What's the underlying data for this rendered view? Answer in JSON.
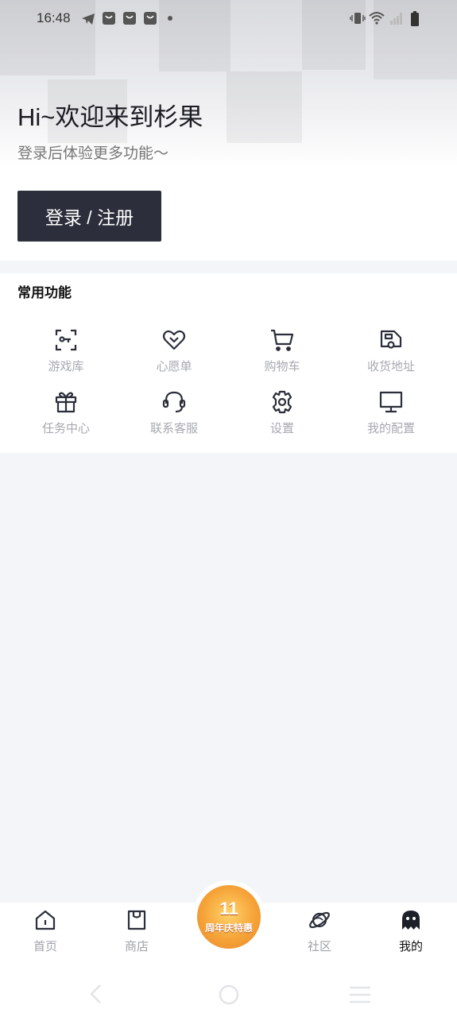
{
  "status_bar": {
    "time": "16:48",
    "left_icons": [
      "telegram-icon",
      "shop-bag-icon",
      "shop-bag-icon",
      "shop-bag-icon",
      "dot-icon"
    ],
    "right_icons": [
      "vibrate-icon",
      "wifi-icon",
      "signal-icon",
      "battery-icon"
    ]
  },
  "header": {
    "greeting": "Hi~欢迎来到杉果",
    "subtitle": "登录后体验更多功能～",
    "login_button": "登录 / 注册"
  },
  "functions": {
    "title": "常用功能",
    "items": [
      {
        "label": "游戏库",
        "icon": "game-library-icon"
      },
      {
        "label": "心愿单",
        "icon": "heart-icon"
      },
      {
        "label": "购物车",
        "icon": "cart-icon"
      },
      {
        "label": "收货地址",
        "icon": "delivery-truck-icon"
      },
      {
        "label": "任务中心",
        "icon": "gift-icon"
      },
      {
        "label": "联系客服",
        "icon": "headset-icon"
      },
      {
        "label": "设置",
        "icon": "gear-icon"
      },
      {
        "label": "我的配置",
        "icon": "monitor-icon"
      }
    ]
  },
  "bottom_nav": {
    "items": [
      {
        "label": "首页",
        "icon": "home-icon"
      },
      {
        "label": "商店",
        "icon": "store-icon"
      },
      {
        "label": "社区",
        "icon": "planet-icon"
      },
      {
        "label": "我的",
        "icon": "ghost-icon",
        "active": true
      }
    ],
    "promo": {
      "number": "11",
      "text": "周年庆特惠"
    }
  },
  "colors": {
    "primary_dark": "#2c2f3b",
    "label_gray": "#a7a9b0",
    "background": "#f4f5f9"
  }
}
